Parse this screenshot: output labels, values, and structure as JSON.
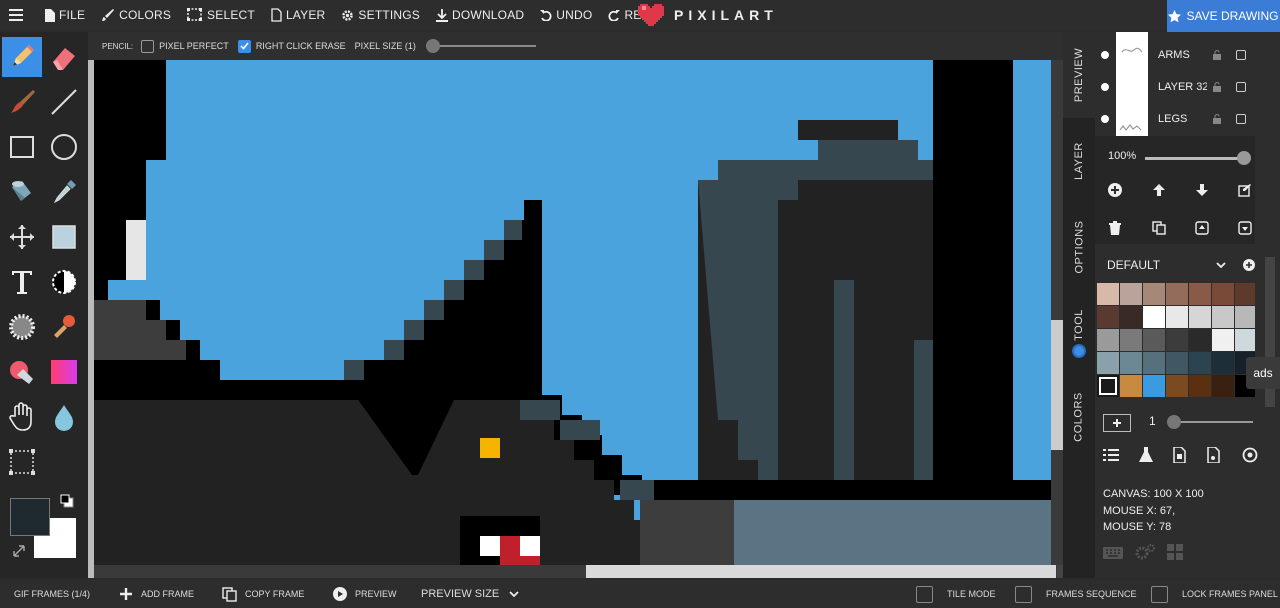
{
  "topbar": {
    "menu": [
      {
        "label": "FILE",
        "icon": "file-icon"
      },
      {
        "label": "COLORS",
        "icon": "brush-icon"
      },
      {
        "label": "SELECT",
        "icon": "select-icon"
      },
      {
        "label": "LAYER",
        "icon": "layer-icon"
      },
      {
        "label": "SETTINGS",
        "icon": "gear-icon"
      },
      {
        "label": "DOWNLOAD",
        "icon": "download-icon"
      },
      {
        "label": "UNDO",
        "icon": "undo-icon"
      },
      {
        "label": "REDO",
        "icon": "redo-icon"
      }
    ],
    "logo_text": "PIXILART",
    "save_label": "SAVE DRAWING",
    "accent": "#3a7cd6"
  },
  "tool_options": {
    "tool_label": "PENCIL:",
    "pixel_perfect_label": "PIXEL PERFECT",
    "pixel_perfect_checked": false,
    "right_click_erase_label": "RIGHT CLICK ERASE",
    "right_click_erase_checked": true,
    "pixel_size_label": "PIXEL SIZE (1)",
    "pixel_size_value": 1
  },
  "tools": [
    "pencil-icon",
    "eraser-icon",
    "brush-icon",
    "line-icon",
    "rectangle-icon",
    "ellipse-icon",
    "fill-bucket-icon",
    "eyedropper-icon",
    "move-icon",
    "shape-fill-icon",
    "text-icon",
    "lighten-icon",
    "dither-icon",
    "stamp-icon",
    "spray-icon",
    "gradient-icon",
    "hand-icon",
    "blur-icon",
    "select-rect-icon"
  ],
  "colors": {
    "primary": "#1e2a30",
    "secondary": "#ffffff"
  },
  "side_tabs": [
    "PREVIEW",
    "LAYER",
    "OPTIONS",
    "TOOL",
    "COLORS"
  ],
  "layers": [
    {
      "name": "ARMS"
    },
    {
      "name": "LAYER 32"
    },
    {
      "name": "LEGS"
    }
  ],
  "layer_opacity": "100%",
  "palette": {
    "name": "DEFAULT",
    "colors": [
      "#d8b8a8",
      "#b9a39a",
      "#a68878",
      "#946c5c",
      "#8a5a48",
      "#7a4a38",
      "#5e3a2c",
      "#5a3a30",
      "#3a2a26",
      "#ffffff",
      "#e8e8e8",
      "#d6d6d6",
      "#c8c8c8",
      "#b8b8b8",
      "#9a9a9a",
      "#7a7a7a",
      "#5a5a5a",
      "#3c3c3c",
      "#2a2a2a",
      "#f0f0f0",
      "#cfd8dc",
      "#8aa0aa",
      "#6c8894",
      "#56707c",
      "#3f5864",
      "#2c4450",
      "#1e2e38",
      "#172028",
      "#1a1a1a",
      "#c88a40",
      "#3b9be0",
      "#7a4a20",
      "#5a3010",
      "#3a2010",
      "#000000"
    ]
  },
  "ads_label": "ads",
  "frames": {
    "add_label": "+",
    "count": "1"
  },
  "info": {
    "canvas": "CANVAS: 100 X 100",
    "mouse_x": "MOUSE X: 67,",
    "mouse_y": "MOUSE Y: 78"
  },
  "bottombar": {
    "gif_frames": "GIF FRAMES (1/4)",
    "add_frame": "ADD FRAME",
    "copy_frame": "COPY FRAME",
    "preview": "PREVIEW",
    "preview_size": "PREVIEW SIZE",
    "tile_mode": "TILE MODE",
    "frames_sequence": "FRAMES SEQUENCE",
    "lock_frames_panel": "LOCK FRAMES PANEL"
  },
  "canvas_art": {
    "sky": "#4aa3dd",
    "black": "#000000",
    "dark": "#222222",
    "slate": "#37474f",
    "mid": "#3d3d3d",
    "eye": "#f4b400",
    "mouth_red": "#c0202a",
    "ground": "#5b7483"
  }
}
